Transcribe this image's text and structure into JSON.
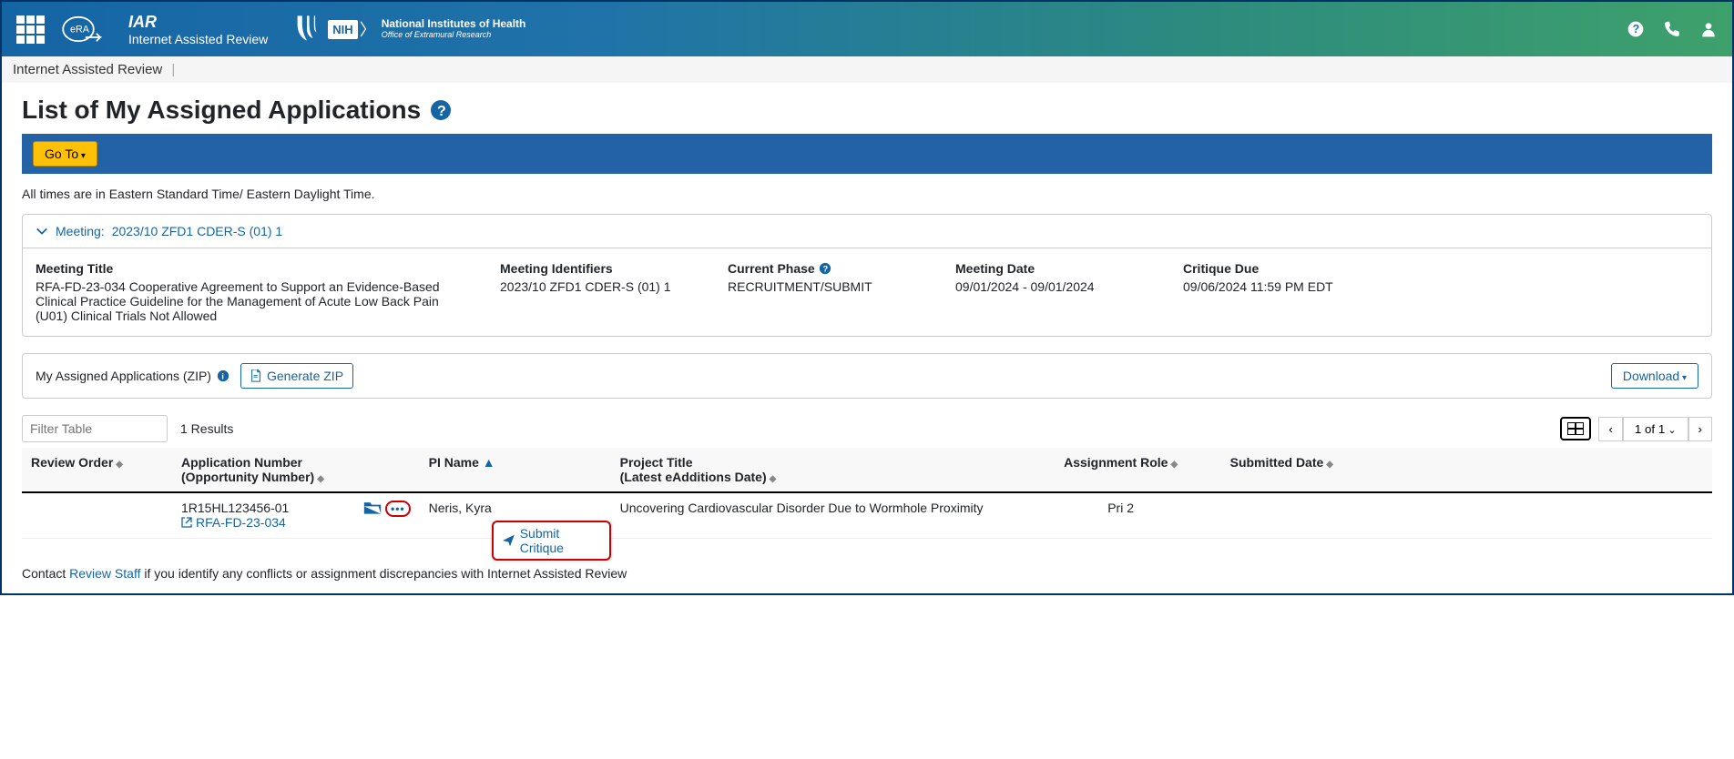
{
  "header": {
    "app_title": "IAR",
    "app_subtitle": "Internet Assisted Review",
    "nih_label": "NIH",
    "nih_text1": "National Institutes of Health",
    "nih_text2": "Office of Extramural Research"
  },
  "breadcrumb": {
    "item1": "Internet Assisted Review"
  },
  "page": {
    "title": "List of My Assigned Applications",
    "goto_label": "Go To",
    "timezone_note": "All times are in Eastern Standard Time/ Eastern Daylight Time."
  },
  "meeting": {
    "header_label": "Meeting:",
    "header_id": "2023/10 ZFD1 CDER-S (01) 1",
    "title_label": "Meeting Title",
    "title_value": "RFA-FD-23-034 Cooperative Agreement to Support an Evidence-Based Clinical Practice Guideline for the Management of Acute Low Back Pain (U01) Clinical Trials Not Allowed",
    "identifiers_label": "Meeting Identifiers",
    "identifiers_value": "2023/10 ZFD1 CDER-S (01) 1",
    "phase_label": "Current Phase",
    "phase_value": "RECRUITMENT/SUBMIT",
    "date_label": "Meeting Date",
    "date_value": "09/01/2024 - 09/01/2024",
    "due_label": "Critique Due",
    "due_value": "09/06/2024 11:59 PM EDT"
  },
  "zip": {
    "label": "My Assigned Applications (ZIP)",
    "generate_btn": "Generate ZIP",
    "download_btn": "Download"
  },
  "table_controls": {
    "filter_placeholder": "Filter Table",
    "results": "1 Results",
    "page_label": "1 of 1"
  },
  "table": {
    "headers": {
      "review_order": "Review Order",
      "app_number": "Application Number",
      "app_number_sub": "(Opportunity Number)",
      "pi_name": "PI Name",
      "project_title": "Project Title",
      "project_title_sub": "(Latest eAdditions Date)",
      "assignment_role": "Assignment Role",
      "submitted_date": "Submitted Date"
    },
    "row": {
      "review_order": "",
      "app_number": "1R15HL123456-01",
      "opportunity": "RFA-FD-23-034",
      "pi_name": "Neris, Kyra",
      "project_title": "Uncovering Cardiovascular Disorder Due to Wormhole Proximity",
      "assignment_role": "Pri 2",
      "submitted_date": ""
    },
    "popup": {
      "submit_critique": "Submit Critique"
    }
  },
  "footer": {
    "prefix": "Contact ",
    "link": "Review Staff",
    "suffix": " if you identify any conflicts or assignment discrepancies with Internet Assisted Review"
  }
}
